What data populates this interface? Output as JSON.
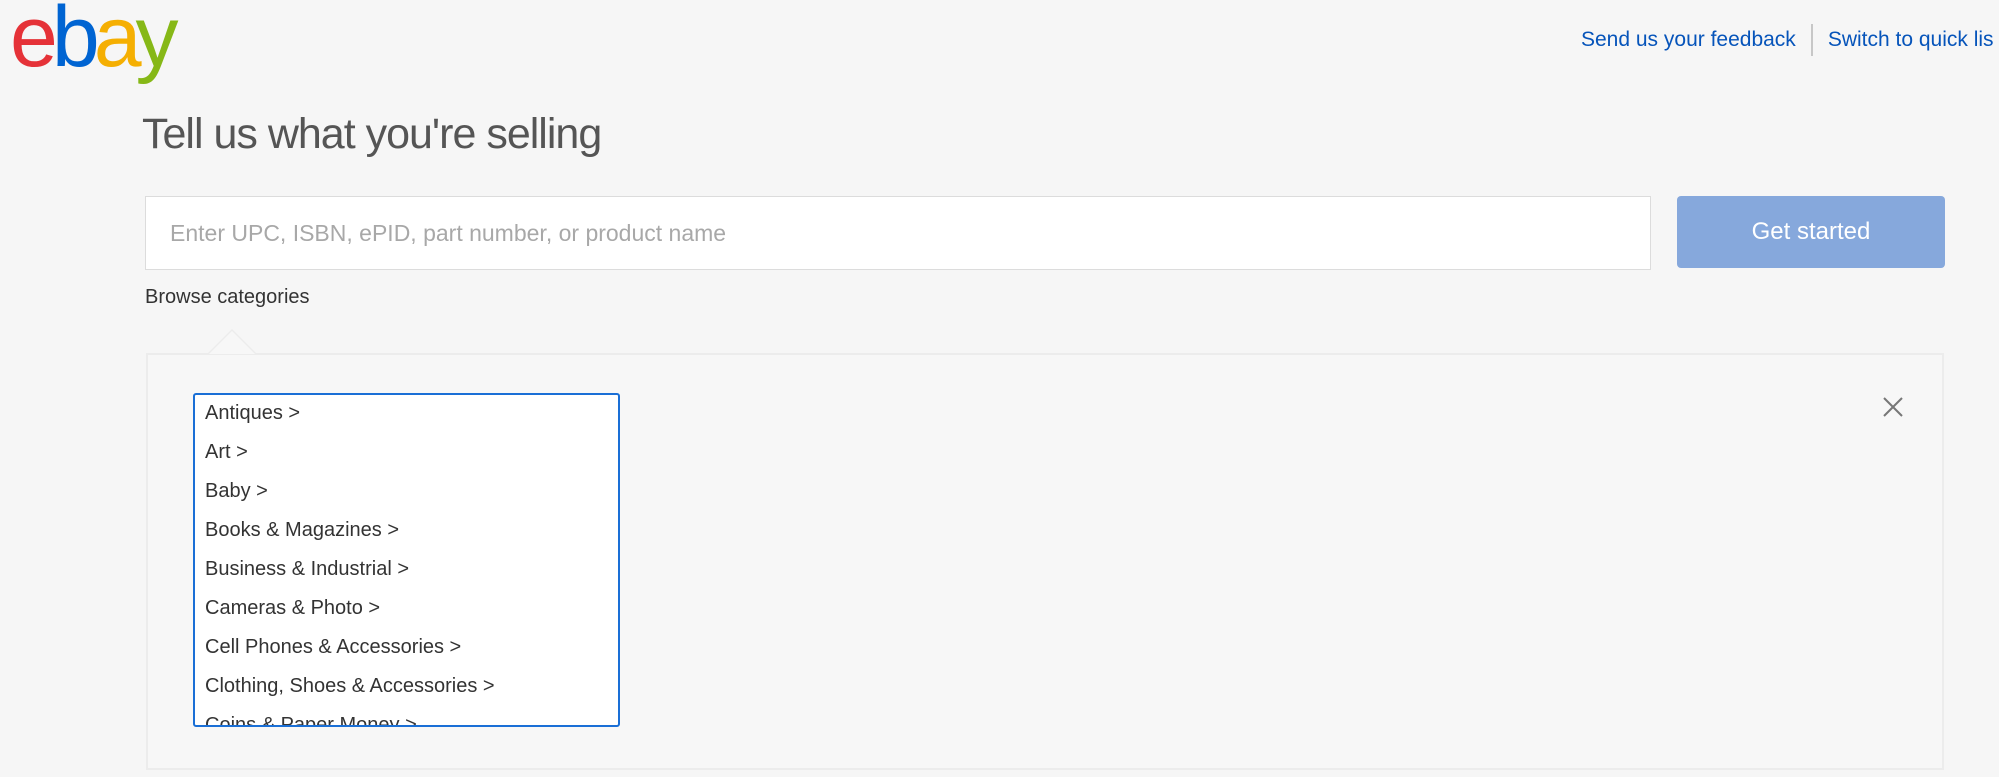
{
  "header": {
    "logo": {
      "letters": [
        {
          "char": "e",
          "color": "#e53238"
        },
        {
          "char": "b",
          "color": "#0064d2"
        },
        {
          "char": "a",
          "color": "#f5af02"
        },
        {
          "char": "y",
          "color": "#86b817"
        }
      ]
    },
    "links": {
      "feedback": "Send us your feedback",
      "quick_listing": "Switch to quick lis"
    }
  },
  "main": {
    "title": "Tell us what you're selling",
    "search": {
      "value": "",
      "placeholder": "Enter UPC, ISBN, ePID, part number, or product name"
    },
    "get_started_label": "Get started",
    "browse_label": "Browse categories",
    "colors": {
      "button": "#86a8dc",
      "link": "#0654ba",
      "listbox_border": "#1a6fd6"
    },
    "categories": [
      "Antiques >",
      "Art >",
      "Baby >",
      "Books & Magazines >",
      "Business & Industrial >",
      "Cameras & Photo >",
      "Cell Phones & Accessories >",
      "Clothing, Shoes & Accessories >",
      "Coins & Paper Money >"
    ],
    "close_icon": "close-x"
  }
}
